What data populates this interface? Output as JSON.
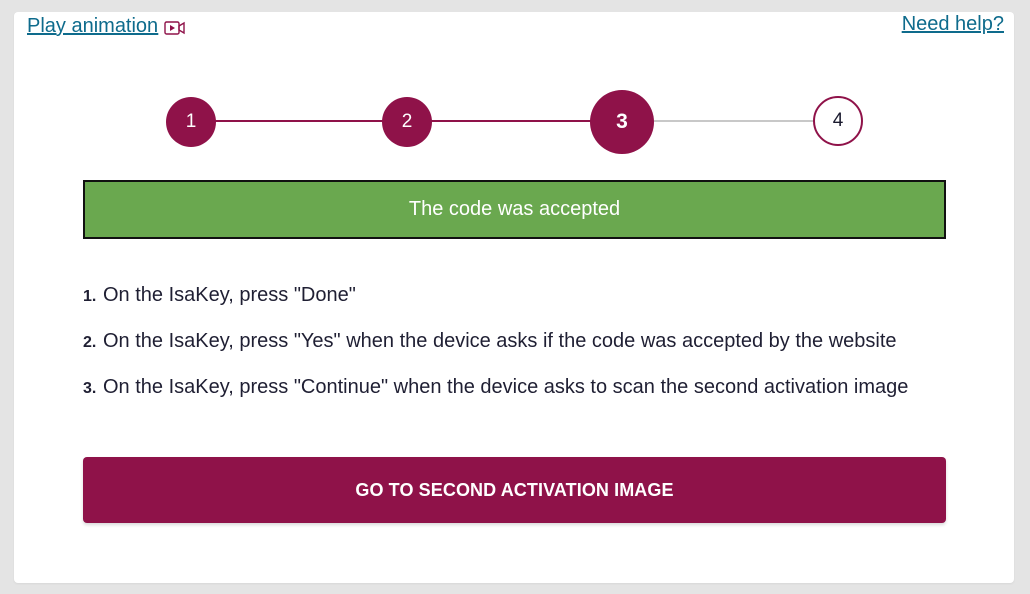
{
  "header": {
    "play_label": "Play animation",
    "play_icon": "video-play-icon",
    "help_label": "Need help?"
  },
  "stepper": {
    "steps": [
      {
        "label": "1",
        "state": "done"
      },
      {
        "label": "2",
        "state": "done"
      },
      {
        "label": "3",
        "state": "current"
      },
      {
        "label": "4",
        "state": "todo"
      }
    ],
    "current_step": 3,
    "total_steps": 4
  },
  "banner": {
    "text": "The code was accepted"
  },
  "instructions": [
    {
      "num": "1.",
      "text": "On the IsaKey, press \"Done\""
    },
    {
      "num": "2.",
      "text": "On the IsaKey, press \"Yes\" when the device asks if the code was accepted by the website"
    },
    {
      "num": "3.",
      "text": "On the IsaKey, press \"Continue\" when the device asks to scan the second activation image"
    }
  ],
  "action": {
    "button_label": "GO TO SECOND ACTIVATION IMAGE"
  },
  "colors": {
    "brand": "#8f1249",
    "success": "#6aa84f",
    "link": "#0e6b8c",
    "connector_inactive": "#c8c8c8"
  }
}
